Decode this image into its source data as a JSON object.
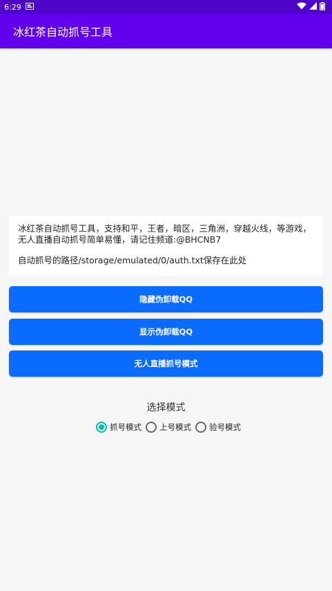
{
  "status_bar": {
    "time": "6:29"
  },
  "app": {
    "title": "冰红茶自动抓号工具"
  },
  "info": {
    "line1": "冰红茶自动抓号工具，支持和平，王者，暗区，三角洲，穿越火线，等游戏，无人直播自动抓号简单易懂，请记住频道:@BHCNB7",
    "line2": "自动抓号的路径/storage/emulated/0/auth.txt保存在此处"
  },
  "buttons": {
    "hide": "隐藏伪卸载QQ",
    "show": "显示伪卸载QQ",
    "live": "无人直播抓号模式"
  },
  "mode": {
    "title": "选择模式",
    "options": [
      {
        "label": "抓号模式",
        "checked": true
      },
      {
        "label": "上号模式",
        "checked": false
      },
      {
        "label": "验号模式",
        "checked": false
      }
    ]
  },
  "colors": {
    "status_bar": "#4f06c8",
    "app_bar": "#6200ee",
    "button": "#0a6cff",
    "radio_checked": "#00bfa5"
  }
}
